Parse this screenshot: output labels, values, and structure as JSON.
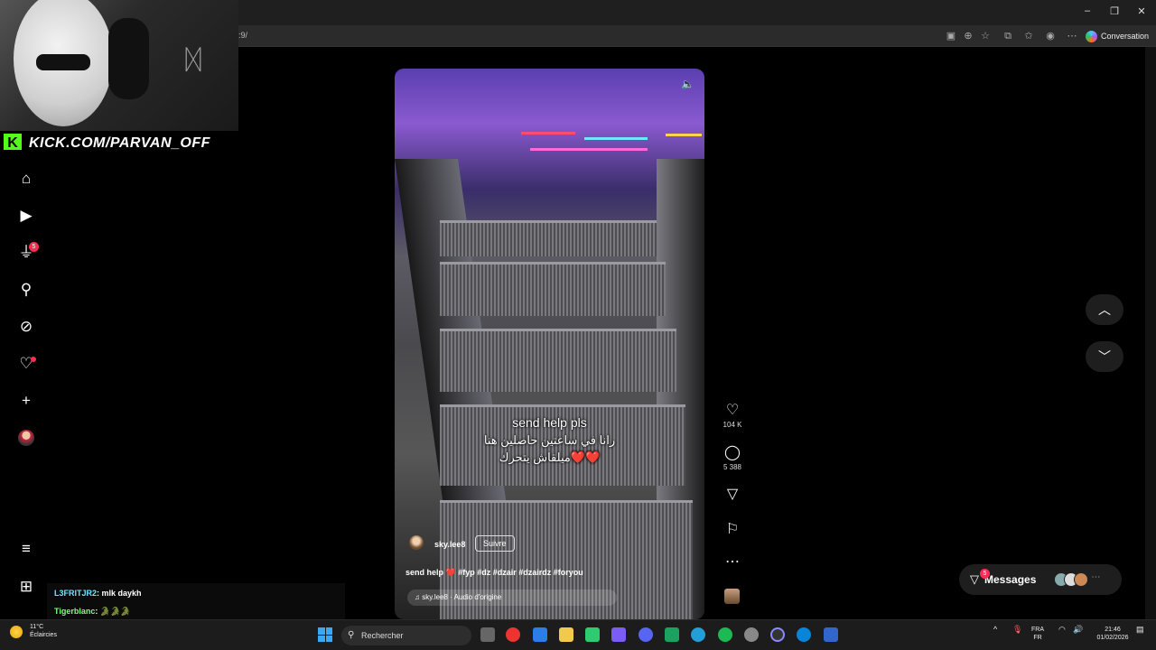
{
  "browser": {
    "address_text": ":9/",
    "conversation_label": "Conversation",
    "window_controls": [
      "minimize",
      "maximize",
      "close"
    ]
  },
  "overlay": {
    "kick_logo": "K",
    "kick_url": "KICK.COM/PARVAN_OFF"
  },
  "sidebar": {
    "items": [
      {
        "icon": "home-icon"
      },
      {
        "icon": "live-icon"
      },
      {
        "icon": "inbox-send-icon",
        "badge": "5"
      },
      {
        "icon": "search-icon"
      },
      {
        "icon": "explore-icon"
      },
      {
        "icon": "heart-icon"
      },
      {
        "icon": "plus-icon"
      },
      {
        "icon": "profile-avatar"
      }
    ],
    "bottom": [
      {
        "icon": "menu-icon"
      },
      {
        "icon": "apps-icon"
      }
    ]
  },
  "chat": {
    "lines": [
      {
        "user": "L3FRITJR2",
        "text": ": mlk daykh",
        "color": "#6ee7ff"
      },
      {
        "user": "Tigerblanc",
        "text": ": 🐊🐊🐊",
        "color": "#7dff7d"
      }
    ]
  },
  "video": {
    "caption_en": "send help pls",
    "caption_ar_1": "رانا في ساعتين حاصلين هنا",
    "caption_ar_2": "ميلقاش يتحرك❤️❤️",
    "creator": "sky.lee8",
    "follow_label": "Suivre",
    "description": "send help ❤️ #fyp #dz #dzair #dzairdz #foryou",
    "audio": "sky.lee8 · Audio d'origine"
  },
  "actions": {
    "likes": "104 K",
    "comments": "5 388"
  },
  "messages": {
    "label": "Messages",
    "badge": "5"
  },
  "taskbar": {
    "weather_temp": "11°C",
    "weather_desc": "Éclaircies",
    "search_placeholder": "Rechercher",
    "lang_1": "FRA",
    "lang_2": "FR",
    "time": "21:46",
    "date": "01/02/2026"
  }
}
